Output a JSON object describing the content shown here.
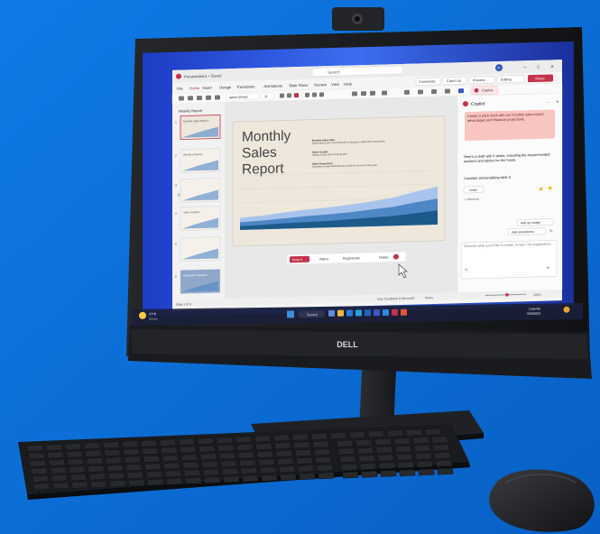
{
  "app": {
    "file_name": "Presentation1 • Saved",
    "search_placeholder": "Search",
    "user_initial": "P",
    "menu_tabs": [
      "File",
      "Home",
      "Insert",
      "Design",
      "Transitions",
      "Animations",
      "Slide Show",
      "Review",
      "View",
      "Help"
    ],
    "comments": "Comments",
    "catch_up": "Catch Up",
    "present": "Present",
    "editing": "Editing",
    "share": "Share",
    "copilot_button": "Copilot",
    "font_name": "Aptos (Body)",
    "font_size": "11"
  },
  "sections": [
    {
      "label": "Weekly Report"
    },
    {
      "label": "Contributions"
    }
  ],
  "thumbnails": [
    {
      "number": "1",
      "text": "Monthly Sales Report"
    },
    {
      "number": "2",
      "text": "Weekly progress"
    },
    {
      "number": "3",
      "text": ""
    },
    {
      "number": "4",
      "text": "Sales Analysis"
    },
    {
      "number": "5",
      "text": ""
    },
    {
      "number": "6",
      "text": "Financial Projections"
    }
  ],
  "slide": {
    "title_lines": [
      "Monthly",
      "Sales",
      "Report"
    ],
    "bullets": [
      {
        "label": "Monthly Sales Data:",
        "text": "Sales have grown from $150,000 in January to $300,000 in December."
      },
      {
        "label": "Sales Growth:",
        "text": "Steady month-over-month growth."
      },
      {
        "label": "Sales Projections:",
        "text": "Expected to reach $350,000 per month by the end of next year."
      }
    ]
  },
  "chart_data": {
    "type": "area",
    "series": [
      {
        "values": [
          22,
          25,
          30,
          34,
          37,
          41,
          46,
          52,
          62,
          70
        ]
      },
      {
        "values": [
          14,
          16,
          19,
          22,
          24,
          27,
          31,
          35,
          42,
          48
        ]
      },
      {
        "values": [
          7,
          8,
          10,
          11,
          12,
          14,
          16,
          18,
          22,
          26
        ]
      }
    ],
    "ylim": [
      0,
      100
    ],
    "colors": [
      "#a8c4ec",
      "#4f86c6",
      "#1c5a8a"
    ]
  },
  "slide_actions": {
    "keep": "Keep it",
    "adjust": "Adjust",
    "regenerate": "Regenerate",
    "delete": "Delete"
  },
  "copilot": {
    "title": "Copilot",
    "user_prompt": "Create a pitch deck with our monthly sales report, advantages and financial projections.",
    "reply": "Here's a draft with 5 slides, including the recommended sections and advice for the future.",
    "followup": "Consider personalizing slide 5.",
    "undo": "Undo",
    "references": "1 reference",
    "add_image": "Add an image",
    "add_animations": "Add animations",
    "input_placeholder": "Describe what you'd like to create, or type / for suggestions."
  },
  "status_bar": {
    "slide_count": "Slide 1 of 6",
    "feedback": "Give Feedback to Microsoft",
    "notes": "Notes",
    "zoom": "100%"
  },
  "taskbar": {
    "weather_temp": "77°F",
    "weather_desc": "Sunny",
    "search": "Search",
    "time": "2:58 PM",
    "date": "3/20/2024"
  },
  "monitor": {
    "brand": "DELL"
  },
  "colors": {
    "background": "#0b6fd6",
    "accent_red": "#c4314b",
    "copilot_pink": "#f9c5c0",
    "slide_beige": "#ede7dc",
    "monitor_body": "#1d1f22"
  }
}
